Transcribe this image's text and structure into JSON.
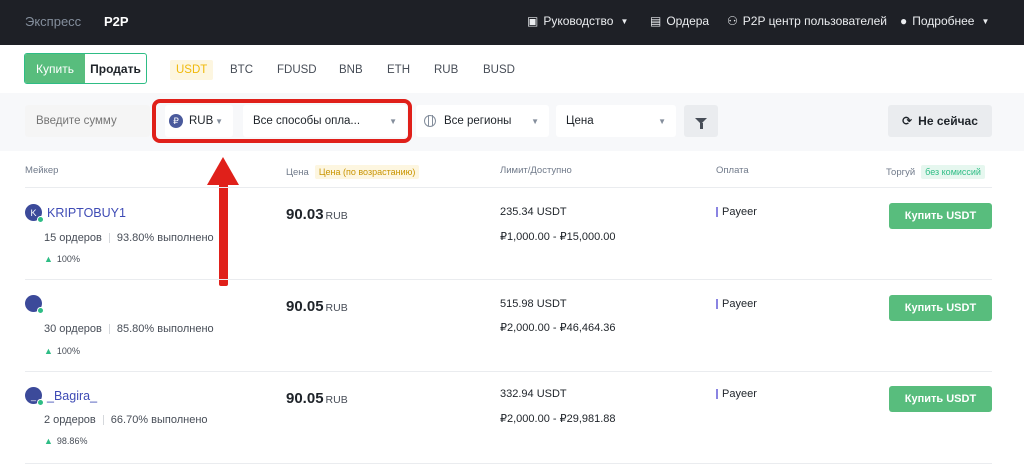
{
  "topbar": {
    "tabs": [
      "Экспресс",
      "P2P"
    ],
    "nav": {
      "guide": "Руководство",
      "orders": "Ордера",
      "center": "P2P центр пользователей",
      "more": "Подробнее"
    }
  },
  "trade_toggle": {
    "buy": "Купить",
    "sell": "Продать"
  },
  "coins": [
    "USDT",
    "BTC",
    "FDUSD",
    "BNB",
    "ETH",
    "RUB",
    "BUSD"
  ],
  "filters": {
    "amount_placeholder": "Введите сумму",
    "currency": "RUB",
    "currency_symbol": "₽",
    "payment": "Все способы опла...",
    "region": "Все регионы",
    "sort": "Цена",
    "refresh": "Не сейчас"
  },
  "table": {
    "headers": {
      "maker": "Мейкер",
      "price": "Цена",
      "price_badge": "Цена (по возрастанию)",
      "limit": "Лимит/Доступно",
      "payment": "Оплата",
      "trade": "Торгуй",
      "trade_badge": "без комиссий"
    },
    "rows": [
      {
        "avatar_letter": "K",
        "name": "KRIPTOBUY1",
        "orders": "15 ордеров",
        "completion": "93.80% выполнено",
        "rating": "100%",
        "price": "90.03",
        "currency": "RUB",
        "available": "235.34 USDT",
        "limits": "₽1,000.00 - ₽15,000.00",
        "payment": "Payeer",
        "action": "Купить USDT"
      },
      {
        "avatar_letter": "",
        "name": "",
        "orders": "30 ордеров",
        "completion": "85.80% выполнено",
        "rating": "100%",
        "price": "90.05",
        "currency": "RUB",
        "available": "515.98 USDT",
        "limits": "₽2,000.00 - ₽46,464.36",
        "payment": "Payeer",
        "action": "Купить USDT"
      },
      {
        "avatar_letter": "_",
        "name": "_Bagira_",
        "orders": "2 ордеров",
        "completion": "66.70% выполнено",
        "rating": "98.86%",
        "price": "90.05",
        "currency": "RUB",
        "available": "332.94 USDT",
        "limits": "₽2,000.00 - ₽29,981.88",
        "payment": "Payeer",
        "action": "Купить USDT"
      }
    ]
  }
}
